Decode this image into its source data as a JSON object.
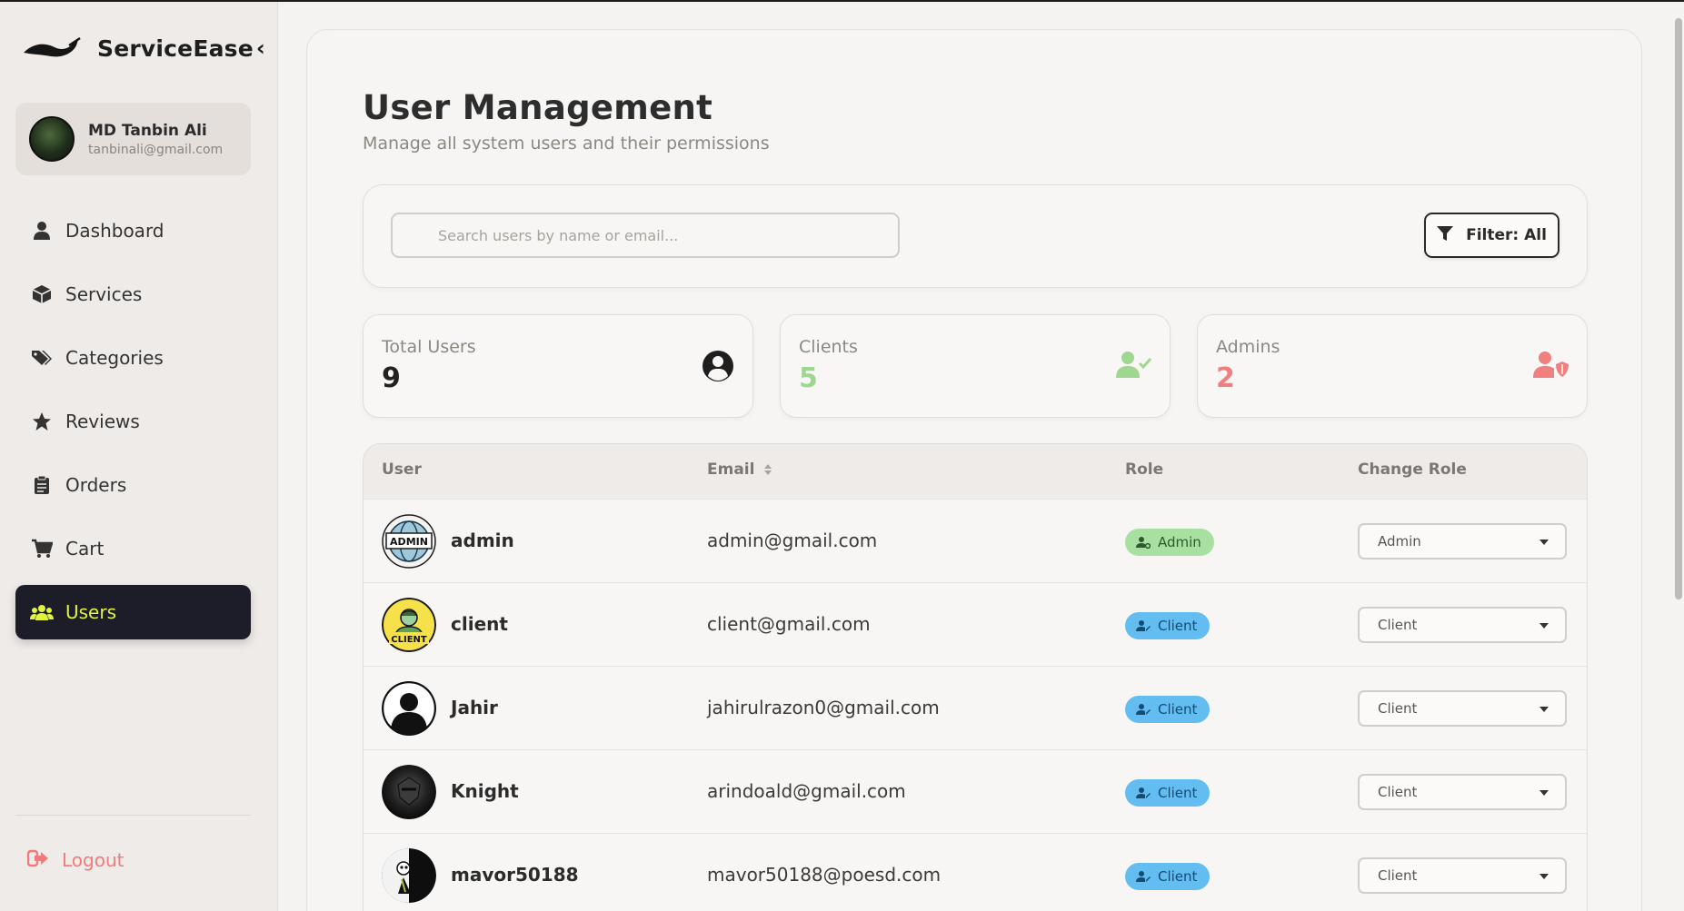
{
  "brand": {
    "name": "ServiceEase",
    "collapse": "‹"
  },
  "profile": {
    "name": "MD Tanbin Ali",
    "email": "tanbinali@gmail.com"
  },
  "nav": [
    {
      "label": "Dashboard",
      "icon": "user-icon"
    },
    {
      "label": "Services",
      "icon": "box-icon"
    },
    {
      "label": "Categories",
      "icon": "tags-icon"
    },
    {
      "label": "Reviews",
      "icon": "star-icon"
    },
    {
      "label": "Orders",
      "icon": "clipboard-icon"
    },
    {
      "label": "Cart",
      "icon": "cart-icon"
    },
    {
      "label": "Users",
      "icon": "users-icon",
      "active": true
    }
  ],
  "logout": {
    "label": "Logout"
  },
  "page": {
    "title": "User Management",
    "subtitle": "Manage all system users and their permissions"
  },
  "search": {
    "placeholder": "Search users by name or email..."
  },
  "filter": {
    "label": "Filter: All"
  },
  "stats": [
    {
      "label": "Total Users",
      "value": "9",
      "color": "#222222",
      "icon": "user-circle-icon"
    },
    {
      "label": "Clients",
      "value": "5",
      "color": "#9fd690",
      "icon": "user-check-icon"
    },
    {
      "label": "Admins",
      "value": "2",
      "color": "#f07f7f",
      "icon": "user-shield-icon"
    }
  ],
  "table": {
    "headers": {
      "user": "User",
      "email": "Email",
      "role": "Role",
      "change": "Change Role"
    },
    "rows": [
      {
        "name": "admin",
        "email": "admin@gmail.com",
        "role": "Admin",
        "select": "Admin"
      },
      {
        "name": "client",
        "email": "client@gmail.com",
        "role": "Client",
        "select": "Client"
      },
      {
        "name": "Jahir",
        "email": "jahirulrazon0@gmail.com",
        "role": "Client",
        "select": "Client"
      },
      {
        "name": "Knight",
        "email": "arindoald@gmail.com",
        "role": "Client",
        "select": "Client"
      },
      {
        "name": "mavor50188",
        "email": "mavor50188@poesd.com",
        "role": "Client",
        "select": "Client"
      }
    ]
  },
  "avatar_text": {
    "admin": "ADMIN",
    "client": "CLIENT"
  },
  "colors": {
    "accent": "#e0f53a",
    "active_bg": "#1d1d29",
    "logout": "#f27a7a",
    "admin_badge": "#a7e0a0",
    "client_badge": "#63bdf1"
  }
}
